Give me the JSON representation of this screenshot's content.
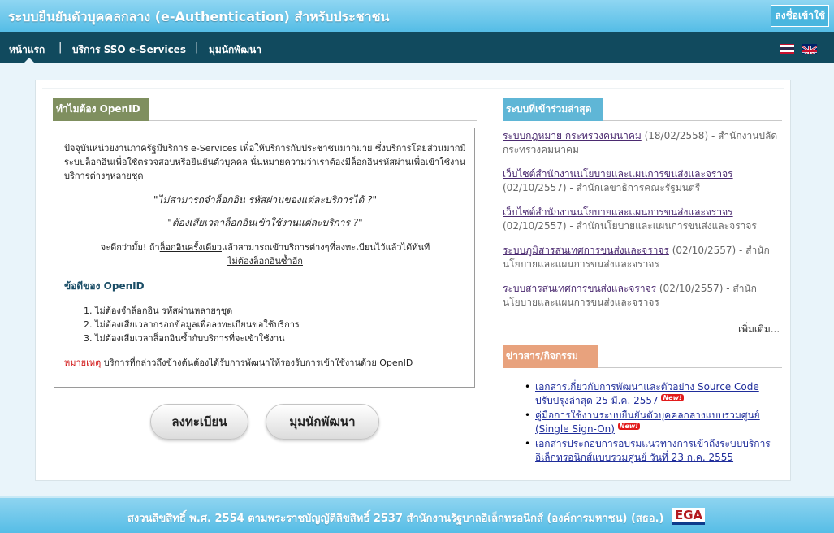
{
  "header": {
    "title": "ระบบยืนยันตัวบุคคลกลาง (e-Authentication) สำหรับประชาชน",
    "login_label": "ลงชื่อเข้าใช้"
  },
  "nav": {
    "items": [
      {
        "label": "หน้าแรก"
      },
      {
        "label": "บริการ SSO e-Services"
      },
      {
        "label": "มุมนักพัฒนา"
      }
    ],
    "separator": "|",
    "flags": [
      "thai-flag-icon",
      "uk-flag-icon"
    ]
  },
  "why": {
    "heading": "ทำไมต้อง OpenID",
    "intro": "ปัจจุบันหน่วยงานภาครัฐมีบริการ e-Services เพื่อให้บริการกับประชาชนมากมาย ซึ่งบริการโดยส่วนมากมีระบบล็อกอินเพื่อใช้ตรวจสอบหรือยืนยันตัวบุคคล นั่นหมายความว่าเราต้องมีล็อกอินรหัสผ่านเพื่อเข้าใช้งานบริการต่างๆหลายชุด",
    "quote1": "\"ไม่สามารถจำล็อกอิน รหัสผ่านของแต่ละบริการได้ ?\"",
    "quote2": "\"ต้องเสียเวลาล็อกอินเข้าใช้งานแต่ละบริการ ?\"",
    "better_prefix": "จะดีกว่ามั้ย! ถ้า",
    "better_link1": "ล็อกอินครั้งเดียว",
    "better_middle": "แล้วสามารถเข้าบริการต่างๆที่ลงทะเบียนไว้แล้วได้ทันที",
    "better_link2": "ไม่ต้องล็อกอินซ้ำอีก",
    "advantages_title": "ข้อดีของ OpenID",
    "advantages": [
      "1. ไม่ต้องจำล็อกอิน รหัสผ่านหลายๆชุด",
      "2. ไม่ต้องเสียเวลากรอกข้อมูลเพื่อลงทะเบียนขอใช้บริการ",
      "3. ไม่ต้องเสียเวลาล็อกอินซ้ำกับบริการที่จะเข้าใช้งาน"
    ],
    "note_label": "หมายเหตุ",
    "note_text": " บริการที่กล่าวถึงข้างต้นต้องได้รับการพัฒนาให้รองรับการเข้าใช้งานด้วย OpenID"
  },
  "buttons": {
    "register": "ลงทะเบียน",
    "developer": "มุมนักพัฒนา"
  },
  "recent": {
    "heading": "ระบบที่เข้าร่วมล่าสุด",
    "items": [
      {
        "link": "ระบบกฎหมาย กระทรวงคมนาคม",
        "rest": " (18/02/2558) - สำนักงานปลัดกระทรวงคมนาคม"
      },
      {
        "link": "เว็บไซต์สำนักงานนโยบายและแผนการขนส่งและจราจร",
        "rest": " (02/10/2557) - สำนักเลขาธิการคณะรัฐมนตรี"
      },
      {
        "link": "เว็บไซต์สำนักงานนโยบายและแผนการขนส่งและจราจร",
        "rest": " (02/10/2557) - สำนักนโยบายและแผนการขนส่งและจราจร"
      },
      {
        "link": "ระบบภูมิสารสนเทศการขนส่งและจราจร",
        "rest": " (02/10/2557) - สำนักนโยบายและแผนการขนส่งและจราจร"
      },
      {
        "link": "ระบบสารสนเทศการขนส่งและจราจร",
        "rest": " (02/10/2557) - สำนักนโยบายและแผนการขนส่งและจราจร"
      }
    ],
    "more_label": "เพิ่มเติม..."
  },
  "news": {
    "heading": "ข่าวสาร/กิจกรรม",
    "bullet": "•",
    "items": [
      {
        "text": "เอกสารเกี่ยวกับการพัฒนาและตัวอย่าง Source Code ปรับปรุงล่าสุด 25 มี.ค. 2557",
        "badge": "New!"
      },
      {
        "text": "คู่มือการใช้งานระบบยืนยันตัวบุคคลกลางแบบรวมศูนย์ (Single Sign-On)",
        "badge": "New!"
      },
      {
        "text": "เอกสารประกอบการอบรมแนวทางการเข้าถึงระบบบริการอิเล็กทรอนิกส์แบบรวมศูนย์ วันที่ 23 ก.ค. 2555",
        "badge": ""
      }
    ]
  },
  "footer": {
    "text": "สงวนลิขสิทธิ์ พ.ศ. 2554 ตามพระราชบัญญัติลิขสิทธิ์ 2537 สำนักงานรัฐบาลอิเล็กทรอนิกส์ (องค์การมหาชน) (สธอ.)",
    "logo_text": "EGA"
  },
  "colors": {
    "header_top": "#8fd6f2",
    "nav_bg": "#114a5e",
    "why_heading": "#7f8f5f",
    "recent_heading": "#5fb6d6",
    "news_heading": "#e8a27d",
    "note_red": "#d01010",
    "news_link": "#1f2d9b",
    "recent_link": "#4b2a70"
  }
}
